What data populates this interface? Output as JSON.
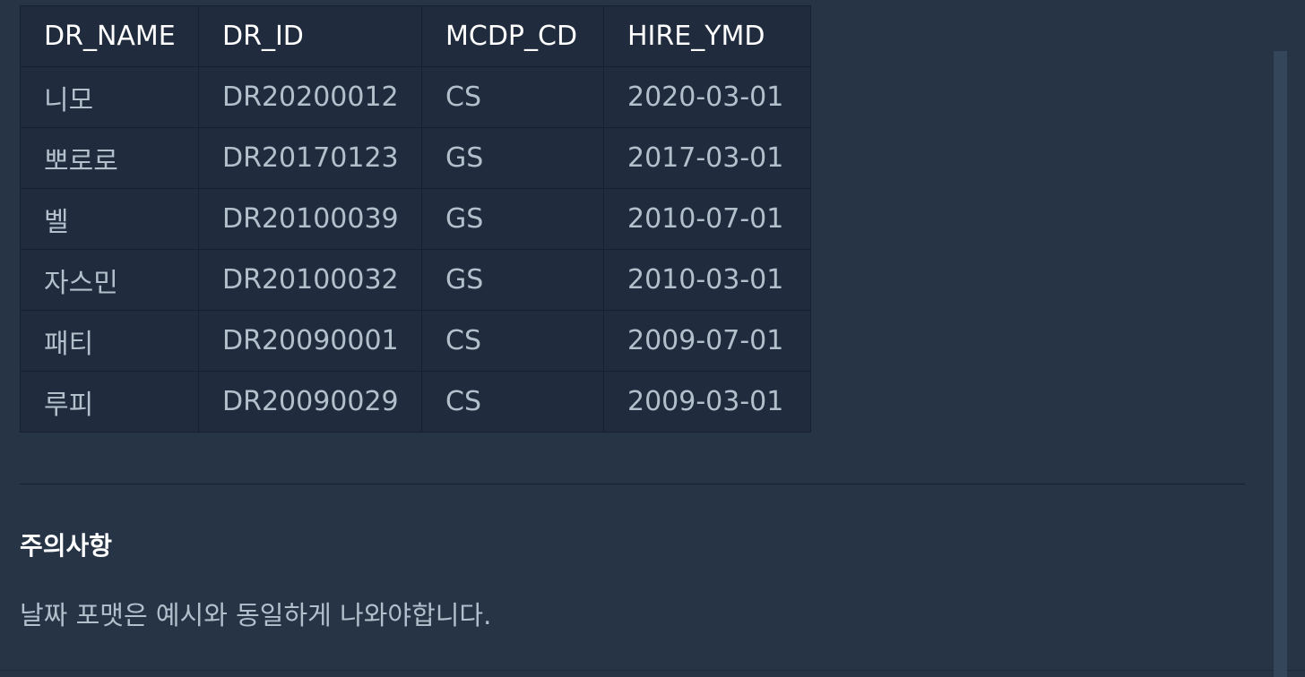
{
  "result_table": {
    "headers": [
      "DR_NAME",
      "DR_ID",
      "MCDP_CD",
      "HIRE_YMD"
    ],
    "rows": [
      [
        "니모",
        "DR20200012",
        "CS",
        "2020-03-01"
      ],
      [
        "뽀로로",
        "DR20170123",
        "GS",
        "2017-03-01"
      ],
      [
        "벨",
        "DR20100039",
        "GS",
        "2010-07-01"
      ],
      [
        "자스민",
        "DR20100032",
        "GS",
        "2010-03-01"
      ],
      [
        "패티",
        "DR20090001",
        "CS",
        "2009-07-01"
      ],
      [
        "루피",
        "DR20090029",
        "CS",
        "2009-03-01"
      ]
    ]
  },
  "notice": {
    "title": "주의사항",
    "text": "날짜 포맷은 예시와 동일하게 나와야합니다."
  },
  "colors": {
    "background": "#263446",
    "table_background": "#202b3d",
    "border": "#172030",
    "header_text": "#ffffff",
    "body_text": "#b2c0cc",
    "scrollbar": "#34465a"
  }
}
